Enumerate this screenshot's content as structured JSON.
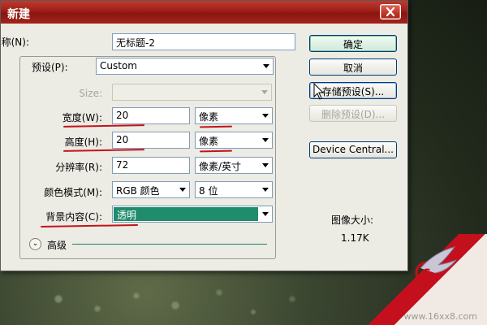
{
  "title": "新建",
  "form": {
    "name_label": "名称(N):",
    "name_value": "无标题-2",
    "preset_label": "预设(P):",
    "preset_value": "Custom",
    "size_label": "Size:",
    "size_value": "",
    "width_label": "宽度(W):",
    "width_value": "20",
    "width_unit": "像素",
    "height_label": "高度(H):",
    "height_value": "20",
    "height_unit": "像素",
    "resolution_label": "分辨率(R):",
    "resolution_value": "72",
    "resolution_unit": "像素/英寸",
    "colormode_label": "颜色模式(M):",
    "colormode_value": "RGB 颜色",
    "bitdepth_value": "8 位",
    "background_label": "背景内容(C):",
    "background_value": "透明",
    "advanced_label": "高级"
  },
  "buttons": {
    "ok": "确定",
    "cancel": "取消",
    "save_preset": "存储预设(S)...",
    "delete_preset": "删除预设(D)...",
    "device_central": "Device Central..."
  },
  "image_size": {
    "label": "图像大小:",
    "value": "1.17K"
  },
  "watermark": {
    "url": "www.16xx8.com"
  },
  "colors": {
    "title_bar": "#9d1f18",
    "dialog_bg": "#ecebe4",
    "highlight": "#1f8c6c",
    "annotation": "#c4141a"
  }
}
